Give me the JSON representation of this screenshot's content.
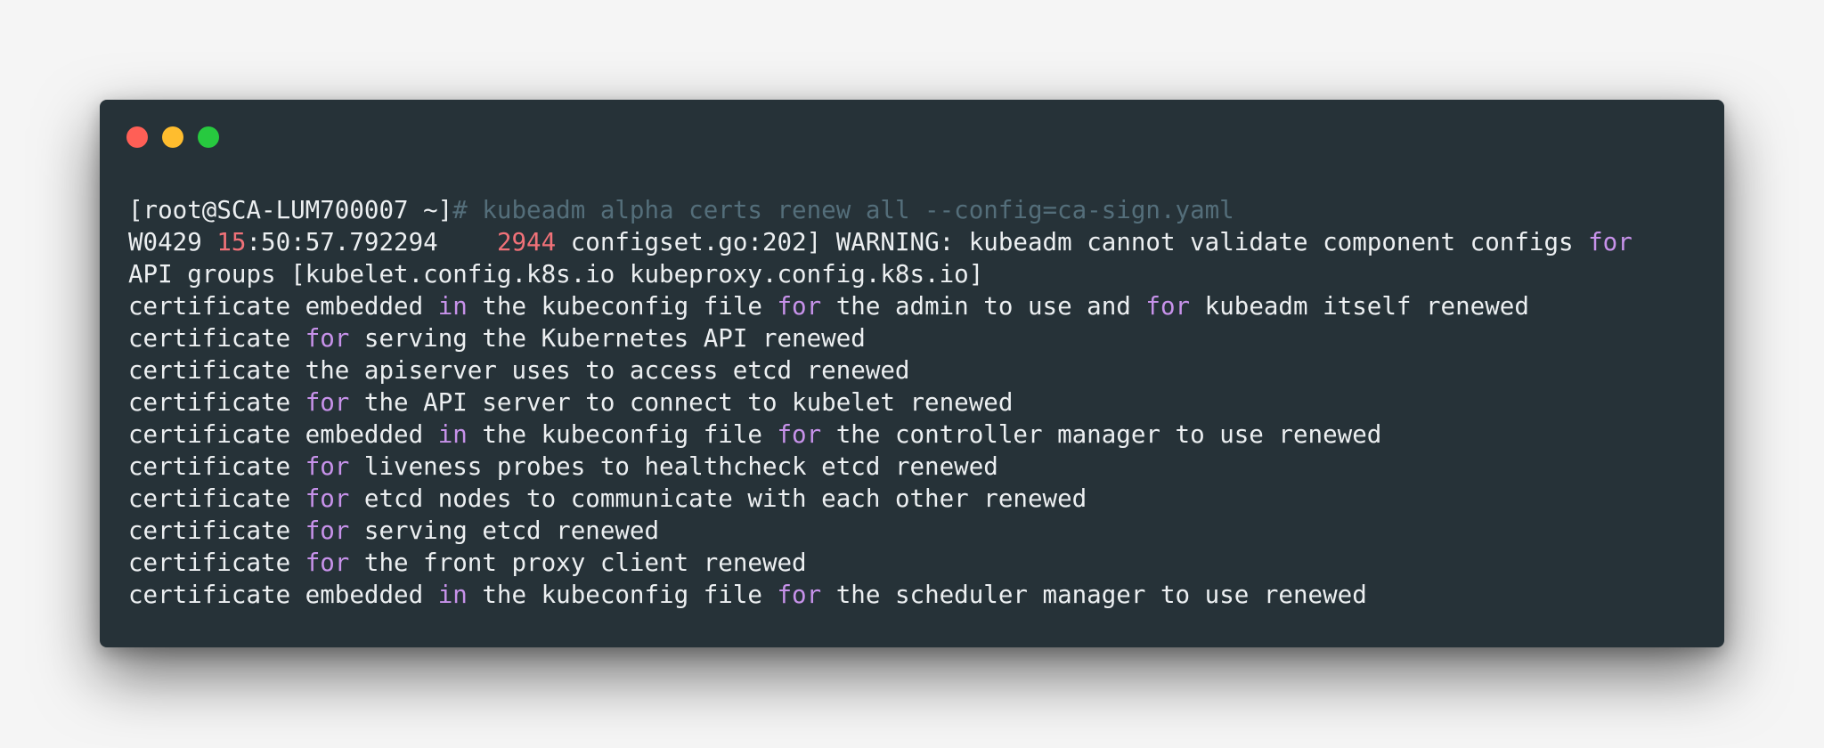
{
  "window": {
    "buttons": {
      "close_color": "#ff5f56",
      "minimize_color": "#ffbd2e",
      "maximize_color": "#27c93f"
    }
  },
  "colors": {
    "background": "#263238",
    "text": "#eceff1",
    "comment": "#546e7a",
    "keyword": "#c792ea",
    "number": "#f07178"
  },
  "terminal": {
    "lines": [
      [
        {
          "text": "[root@SCA-LUM700007 ~]",
          "style": "text"
        },
        {
          "text": "# kubeadm alpha certs renew all --config=ca-sign.yaml",
          "style": "comment"
        }
      ],
      [
        {
          "text": "W0429 ",
          "style": "text"
        },
        {
          "text": "15",
          "style": "number"
        },
        {
          "text": ":50:57.792294    ",
          "style": "text"
        },
        {
          "text": "2944",
          "style": "number"
        },
        {
          "text": " configset.go:202] WARNING: kubeadm cannot validate component configs ",
          "style": "text"
        },
        {
          "text": "for",
          "style": "keyword"
        }
      ],
      [
        {
          "text": "API groups [kubelet.config.k8s.io kubeproxy.config.k8s.io]",
          "style": "text"
        }
      ],
      [
        {
          "text": "certificate embedded ",
          "style": "text"
        },
        {
          "text": "in",
          "style": "keyword"
        },
        {
          "text": " the kubeconfig file ",
          "style": "text"
        },
        {
          "text": "for",
          "style": "keyword"
        },
        {
          "text": " the admin to use and ",
          "style": "text"
        },
        {
          "text": "for",
          "style": "keyword"
        },
        {
          "text": " kubeadm itself renewed",
          "style": "text"
        }
      ],
      [
        {
          "text": "certificate ",
          "style": "text"
        },
        {
          "text": "for",
          "style": "keyword"
        },
        {
          "text": " serving the Kubernetes API renewed",
          "style": "text"
        }
      ],
      [
        {
          "text": "certificate the apiserver uses to access etcd renewed",
          "style": "text"
        }
      ],
      [
        {
          "text": "certificate ",
          "style": "text"
        },
        {
          "text": "for",
          "style": "keyword"
        },
        {
          "text": " the API server to connect to kubelet renewed",
          "style": "text"
        }
      ],
      [
        {
          "text": "certificate embedded ",
          "style": "text"
        },
        {
          "text": "in",
          "style": "keyword"
        },
        {
          "text": " the kubeconfig file ",
          "style": "text"
        },
        {
          "text": "for",
          "style": "keyword"
        },
        {
          "text": " the controller manager to use renewed",
          "style": "text"
        }
      ],
      [
        {
          "text": "certificate ",
          "style": "text"
        },
        {
          "text": "for",
          "style": "keyword"
        },
        {
          "text": " liveness probes to healthcheck etcd renewed",
          "style": "text"
        }
      ],
      [
        {
          "text": "certificate ",
          "style": "text"
        },
        {
          "text": "for",
          "style": "keyword"
        },
        {
          "text": " etcd nodes to communicate with each other renewed",
          "style": "text"
        }
      ],
      [
        {
          "text": "certificate ",
          "style": "text"
        },
        {
          "text": "for",
          "style": "keyword"
        },
        {
          "text": " serving etcd renewed",
          "style": "text"
        }
      ],
      [
        {
          "text": "certificate ",
          "style": "text"
        },
        {
          "text": "for",
          "style": "keyword"
        },
        {
          "text": " the front proxy client renewed",
          "style": "text"
        }
      ],
      [
        {
          "text": "certificate embedded ",
          "style": "text"
        },
        {
          "text": "in",
          "style": "keyword"
        },
        {
          "text": " the kubeconfig file ",
          "style": "text"
        },
        {
          "text": "for",
          "style": "keyword"
        },
        {
          "text": " the scheduler manager to use renewed",
          "style": "text"
        }
      ]
    ]
  }
}
